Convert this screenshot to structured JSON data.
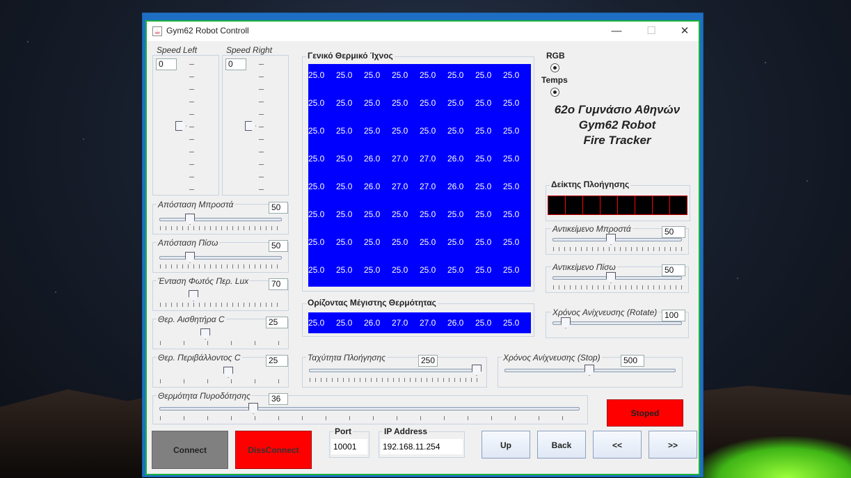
{
  "window": {
    "title": "Gym62 Robot Controll",
    "min": "—",
    "max": "☐",
    "close": "✕"
  },
  "speed": {
    "left_label": "Speed Left",
    "left_value": "0",
    "right_label": "Speed Right",
    "right_value": "0"
  },
  "left_sliders": [
    {
      "label": "Απόσταση Μπροστά",
      "value": "50"
    },
    {
      "label": "Απόσταση Πίσω",
      "value": "50"
    },
    {
      "label": "Ένταση Φωτός Περ. Lux",
      "value": "70"
    },
    {
      "label": "Θερ. Αισθητήρα C",
      "value": "25"
    },
    {
      "label": "Θερ. Περιβάλλοντος C",
      "value": "25"
    }
  ],
  "fire_temp": {
    "label": "Θερμότητα Πυροδότησης",
    "value": "36"
  },
  "thermal": {
    "title": "Γενικό Θερμικό Ίχνος",
    "rows": [
      [
        "25.0",
        "25.0",
        "25.0",
        "25.0",
        "25.0",
        "25.0",
        "25.0",
        "25.0"
      ],
      [
        "25.0",
        "25.0",
        "25.0",
        "25.0",
        "25.0",
        "25.0",
        "25.0",
        "25.0"
      ],
      [
        "25.0",
        "25.0",
        "25.0",
        "25.0",
        "25.0",
        "25.0",
        "25.0",
        "25.0"
      ],
      [
        "25.0",
        "25.0",
        "26.0",
        "27.0",
        "27.0",
        "26.0",
        "25.0",
        "25.0"
      ],
      [
        "25.0",
        "25.0",
        "26.0",
        "27.0",
        "27.0",
        "26.0",
        "25.0",
        "25.0"
      ],
      [
        "25.0",
        "25.0",
        "25.0",
        "25.0",
        "25.0",
        "25.0",
        "25.0",
        "25.0"
      ],
      [
        "25.0",
        "25.0",
        "25.0",
        "25.0",
        "25.0",
        "25.0",
        "25.0",
        "25.0"
      ],
      [
        "25.0",
        "25.0",
        "25.0",
        "25.0",
        "25.0",
        "25.0",
        "25.0",
        "25.0"
      ]
    ],
    "color": "#0000ff"
  },
  "horizon": {
    "title": "Ορίζοντας Μέγιστης Θερμότητας",
    "values": [
      "25.0",
      "25.0",
      "26.0",
      "27.0",
      "27.0",
      "26.0",
      "25.0",
      "25.0"
    ]
  },
  "nav_speed": {
    "label": "Ταχύτητα Πλοήγησης",
    "value": "250"
  },
  "detect_stop": {
    "label": "Χρόνος Ανίχνευσης (Stop)",
    "value": "500"
  },
  "radio": {
    "rgb": "RGB",
    "temps": "Temps"
  },
  "heading": {
    "line1": "62ο Γυμνάσιο Αθηνών",
    "line2": "Gym62 Robot",
    "line3": "Fire Tracker"
  },
  "nav_indicator": {
    "title": "Δείκτης Πλοήγησης",
    "cells": 8,
    "color": "#ff0000"
  },
  "right_sliders": [
    {
      "label": "Αντικείμενο Μπροστά",
      "value": "50"
    },
    {
      "label": "Αντικείμενο Πίσω",
      "value": "50"
    },
    {
      "label": "Χρόνος Ανίχνευσης (Rotate)",
      "value": "100"
    }
  ],
  "status": {
    "text": "Stoped",
    "color": "#ff0000"
  },
  "buttons": {
    "connect": "Connect",
    "disconnect": "DissConnect",
    "up": "Up",
    "back": "Back",
    "left": "<<",
    "right": ">>"
  },
  "port": {
    "label": "Port",
    "value": "10001"
  },
  "ip": {
    "label": "IP Address",
    "value": "192.168.11.254"
  }
}
